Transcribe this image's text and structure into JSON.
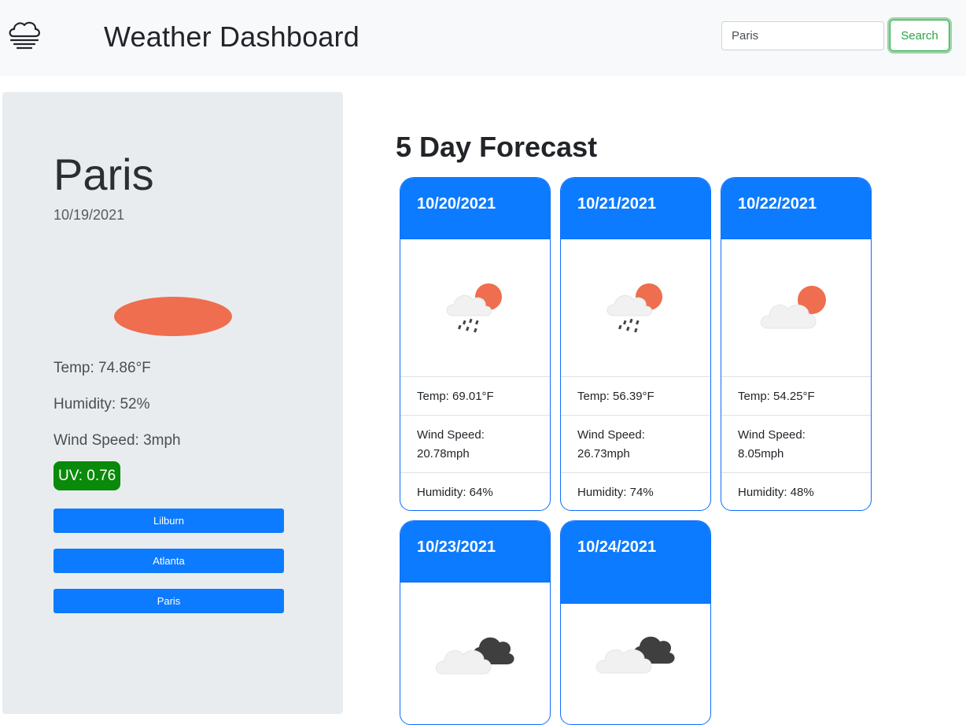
{
  "header": {
    "logo_icon": "fog-cloud-icon",
    "title": "Weather Dashboard",
    "search_value": "Paris",
    "search_button": "Search"
  },
  "current": {
    "city": "Paris",
    "date": "10/19/2021",
    "icon": "weather-icon",
    "temp": "Temp: 74.86°F",
    "humidity": "Humidity: 52%",
    "wind": "Wind Speed: 3mph",
    "uv": "UV: 0.76",
    "uv_color": "#0a8a0a"
  },
  "history": [
    "Lilburn",
    "Atlanta",
    "Paris"
  ],
  "forecast": {
    "title": "5 Day Forecast",
    "days": [
      {
        "date": "10/20/2021",
        "icon": "rain-sun-cloud-icon",
        "temp": "Temp: 69.01°F",
        "wind_label": "Wind Speed:",
        "wind_value": "20.78mph",
        "humidity": "Humidity: 64%"
      },
      {
        "date": "10/21/2021",
        "icon": "rain-sun-cloud-icon",
        "temp": "Temp: 56.39°F",
        "wind_label": "Wind Speed:",
        "wind_value": "26.73mph",
        "humidity": "Humidity: 74%"
      },
      {
        "date": "10/22/2021",
        "icon": "sun-cloud-icon",
        "temp": "Temp: 54.25°F",
        "wind_label": "Wind Speed:",
        "wind_value": "8.05mph",
        "humidity": "Humidity: 48%"
      },
      {
        "date": "10/23/2021",
        "icon": "dark-cloud-icon"
      },
      {
        "date": "10/24/2021",
        "icon": "dark-cloud-icon"
      }
    ]
  },
  "colors": {
    "accent": "#0d7bff",
    "success": "#28a745",
    "sun": "#ee6e4f"
  }
}
